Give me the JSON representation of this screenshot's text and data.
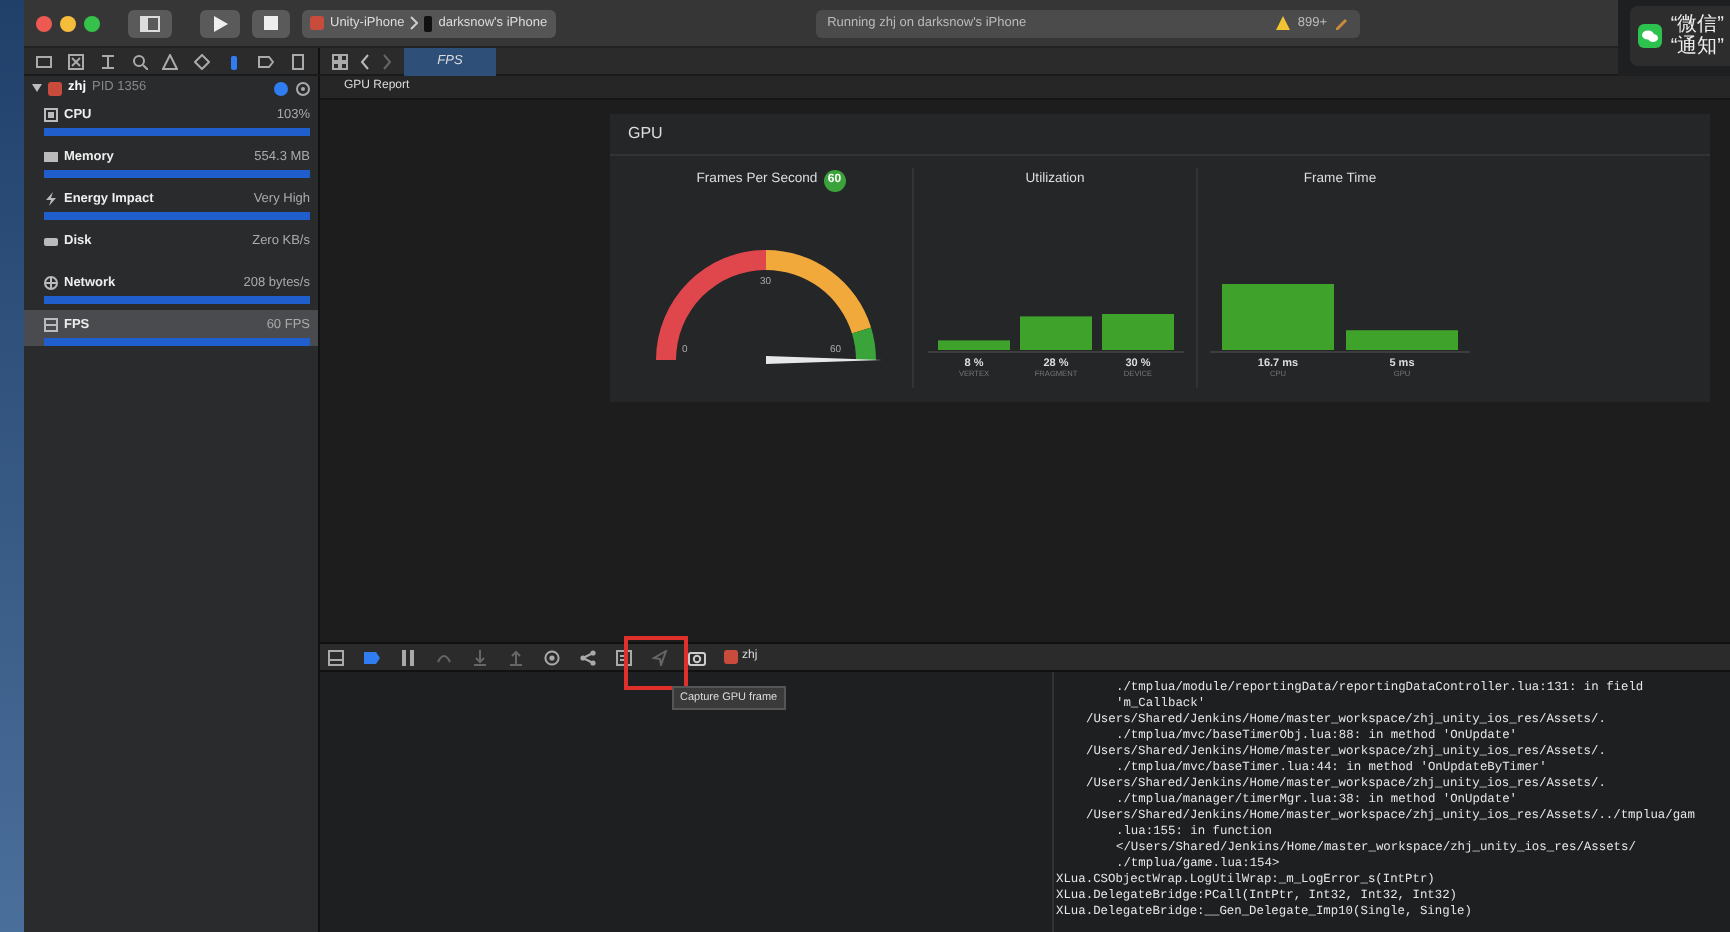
{
  "toolbar": {
    "scheme": "Unity-iPhone",
    "device": "darksnow's iPhone",
    "status": "Running zhj on darksnow's iPhone",
    "warnings": "899+"
  },
  "editor_tabs": [
    {
      "label": "FPS",
      "selected": true
    }
  ],
  "process": {
    "name": "zhj",
    "pid": "PID 1356",
    "expanded": true
  },
  "gauges": [
    {
      "name": "CPU",
      "value": "103%",
      "level": 1,
      "selected": false
    },
    {
      "name": "Memory",
      "value": "554.3 MB",
      "level": 1,
      "selected": false
    },
    {
      "name": "Energy Impact",
      "value": "Very High",
      "level": 1,
      "selected": false
    },
    {
      "name": "Disk",
      "value": "Zero KB/s",
      "selected": false
    },
    {
      "name": "Network",
      "value": "208 bytes/s",
      "level": 1,
      "selected": false
    },
    {
      "name": "FPS",
      "value": "60 FPS",
      "level": 1,
      "selected": true
    }
  ],
  "report": {
    "title": "GPU Report",
    "panel_title": "GPU",
    "fps": {
      "title": "Frames Per Second",
      "badge": "60",
      "ticks": [
        "0",
        "30",
        "60"
      ]
    },
    "utilization": {
      "chart_data": {
        "type": "bar",
        "title": "Utilization",
        "categories": [
          "VERTEX",
          "FRAGMENT",
          "DEVICE"
        ],
        "values": [
          8,
          28,
          30
        ],
        "value_labels": [
          "8 %",
          "28 %",
          "30 %"
        ]
      }
    },
    "frame_time": {
      "chart_data": {
        "type": "bar",
        "title": "Frame Time",
        "categories": [
          "CPU",
          "GPU"
        ],
        "values": [
          16.7,
          5
        ],
        "value_labels": [
          "16.7 ms",
          "5 ms"
        ]
      }
    }
  },
  "debug_bar": {
    "target": "zhj",
    "tooltip": "Capture GPU frame"
  },
  "console": [
    {
      "kind": "indent",
      "text": "./tmplua/module/reportingData/reportingDataController.lua:131: in field"
    },
    {
      "kind": "indent",
      "text": "'m_Callback'"
    },
    {
      "kind": "path",
      "text": "/Users/Shared/Jenkins/Home/master_workspace/zhj_unity_ios_res/Assets/."
    },
    {
      "kind": "indent",
      "text": "./tmplua/mvc/baseTimerObj.lua:88: in method 'OnUpdate'"
    },
    {
      "kind": "path",
      "text": "/Users/Shared/Jenkins/Home/master_workspace/zhj_unity_ios_res/Assets/."
    },
    {
      "kind": "indent",
      "text": "./tmplua/mvc/baseTimer.lua:44: in method 'OnUpdateByTimer'"
    },
    {
      "kind": "path",
      "text": "/Users/Shared/Jenkins/Home/master_workspace/zhj_unity_ios_res/Assets/."
    },
    {
      "kind": "indent",
      "text": "./tmplua/manager/timerMgr.lua:38: in method 'OnUpdate'"
    },
    {
      "kind": "path",
      "text": "/Users/Shared/Jenkins/Home/master_workspace/zhj_unity_ios_res/Assets/../tmplua/gam"
    },
    {
      "kind": "indent",
      "text": ".lua:155: in function"
    },
    {
      "kind": "indent",
      "text": "</Users/Shared/Jenkins/Home/master_workspace/zhj_unity_ios_res/Assets/"
    },
    {
      "kind": "indent",
      "text": "./tmplua/game.lua:154>"
    },
    {
      "kind": "top",
      "text": "XLua.CSObjectWrap.LogUtilWrap:_m_LogError_s(IntPtr)"
    },
    {
      "kind": "top",
      "text": "XLua.DelegateBridge:PCall(IntPtr, Int32, Int32, Int32)"
    },
    {
      "kind": "top",
      "text": "XLua.DelegateBridge:__Gen_Delegate_Imp10(Single, Single)"
    }
  ],
  "notification": {
    "lines": [
      "“微信”",
      "“通知”"
    ]
  }
}
